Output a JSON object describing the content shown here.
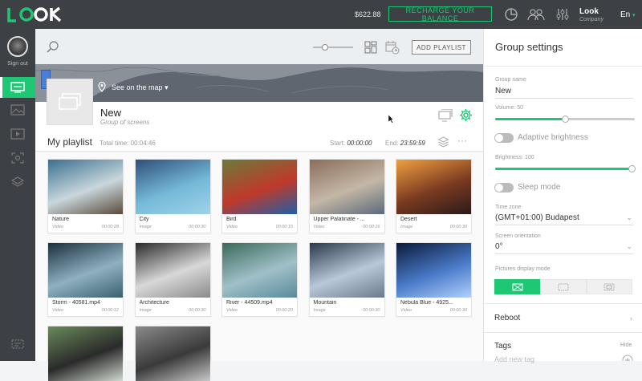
{
  "topbar": {
    "balance": "$622.88",
    "recharge_label": "RECHARGE YOUR BALANCE",
    "user_name": "Look",
    "user_company": "Company",
    "language": "En",
    "colors": {
      "accent": "#1ec773",
      "bar": "#3d4045"
    }
  },
  "sidebar": {
    "sign_out_label": "Sign out",
    "items": [
      {
        "icon": "screens-icon",
        "active": true
      },
      {
        "icon": "images-icon",
        "active": false
      },
      {
        "icon": "video-icon",
        "active": false
      },
      {
        "icon": "focus-icon",
        "active": false
      },
      {
        "icon": "layers-icon",
        "active": false
      }
    ]
  },
  "toolbar": {
    "add_playlist_label": "ADD PLAYLIST"
  },
  "map": {
    "see_on_map_label": "See on the map"
  },
  "group": {
    "name": "New",
    "subtitle": "Group of screens"
  },
  "playlist": {
    "title": "My playlist",
    "total_time": "Total time: 00:04:46",
    "start_label": "Start:",
    "start_value": "00:00:00",
    "end_label": "End:",
    "end_value": "23:59:59",
    "items": [
      {
        "title": "Nature",
        "type": "Video",
        "duration": "00:00:28"
      },
      {
        "title": "City",
        "type": "Image",
        "duration": "00:00:30"
      },
      {
        "title": "Bird",
        "type": "Video",
        "duration": "00:00:15"
      },
      {
        "title": "Upper Palatinate - ...",
        "type": "Video",
        "duration": "00:00:16"
      },
      {
        "title": "Desert",
        "type": "Image",
        "duration": "00:00:30"
      },
      {
        "title": "Storm - 40581.mp4",
        "type": "Video",
        "duration": "00:00:12"
      },
      {
        "title": "Architecture",
        "type": "Image",
        "duration": "00:00:30"
      },
      {
        "title": "River - 44509.mp4",
        "type": "Video",
        "duration": "00:00:20"
      },
      {
        "title": "Mountain",
        "type": "Image",
        "duration": "00:00:30"
      },
      {
        "title": "Nebula Blue - 4925...",
        "type": "Video",
        "duration": "00:00:30"
      },
      {
        "title": "",
        "type": "",
        "duration": ""
      },
      {
        "title": "",
        "type": "",
        "duration": ""
      }
    ]
  },
  "panel": {
    "title": "Group settings",
    "group_name_label": "Group name",
    "group_name_value": "New",
    "volume_label": "Volume: 50",
    "volume": 50,
    "adaptive_brightness_label": "Adaptive brightness",
    "adaptive_brightness_on": false,
    "brightness_label": "Brightness: 100",
    "brightness": 100,
    "sleep_mode_label": "Sleep mode",
    "sleep_mode_on": false,
    "timezone_label": "Time zone",
    "timezone_value": "(GMT+01:00) Budapest",
    "orientation_label": "Screen orientation",
    "orientation_value": "0°",
    "display_mode_label": "Pictures display mode",
    "display_mode_selected": 0,
    "reboot_label": "Reboot",
    "tags_label": "Tags",
    "tags_hide_label": "Hide",
    "add_tag_placeholder": "Add new tag"
  }
}
